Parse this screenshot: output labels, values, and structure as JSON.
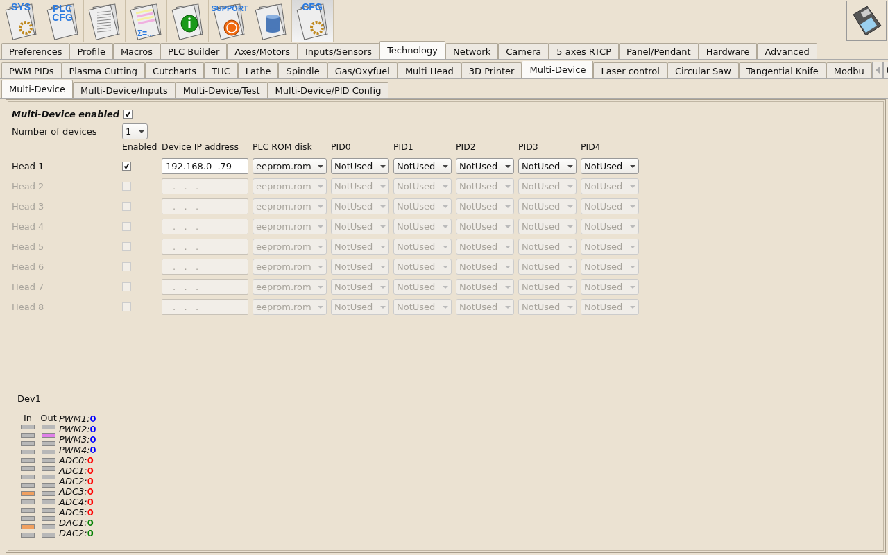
{
  "toolbar": [
    {
      "kind": "gear",
      "label": "SYS",
      "selected": false
    },
    {
      "kind": "text",
      "label": "PLC CFG",
      "selected": false
    },
    {
      "kind": "lines",
      "selected": false
    },
    {
      "kind": "sheet",
      "label": "Σ=...",
      "selected": false
    },
    {
      "kind": "info",
      "selected": false
    },
    {
      "kind": "phone",
      "label": "SUPPORT",
      "selected": false
    },
    {
      "kind": "database",
      "selected": false
    },
    {
      "kind": "gear",
      "label": "CFG",
      "selected": true
    }
  ],
  "main_tabs": [
    {
      "label": "Preferences",
      "selected": false
    },
    {
      "label": "Profile",
      "selected": false
    },
    {
      "label": "Macros",
      "selected": false
    },
    {
      "label": "PLC Builder",
      "selected": false
    },
    {
      "label": "Axes/Motors",
      "selected": false
    },
    {
      "label": "Inputs/Sensors",
      "selected": false
    },
    {
      "label": "Technology",
      "selected": true
    },
    {
      "label": "Network",
      "selected": false
    },
    {
      "label": "Camera",
      "selected": false
    },
    {
      "label": "5 axes RTCP",
      "selected": false
    },
    {
      "label": "Panel/Pendant",
      "selected": false
    },
    {
      "label": "Hardware",
      "selected": false
    },
    {
      "label": "Advanced",
      "selected": false
    }
  ],
  "tech_tabs": [
    {
      "label": "PWM PIDs",
      "selected": false
    },
    {
      "label": "Plasma Cutting",
      "selected": false
    },
    {
      "label": "Cutcharts",
      "selected": false
    },
    {
      "label": "THC",
      "selected": false
    },
    {
      "label": "Lathe",
      "selected": false
    },
    {
      "label": "Spindle",
      "selected": false
    },
    {
      "label": "Gas/Oxyfuel",
      "selected": false
    },
    {
      "label": "Multi Head",
      "selected": false
    },
    {
      "label": "3D Printer",
      "selected": false
    },
    {
      "label": "Multi-Device",
      "selected": true
    },
    {
      "label": "Laser control",
      "selected": false
    },
    {
      "label": "Circular Saw",
      "selected": false
    },
    {
      "label": "Tangential Knife",
      "selected": false
    },
    {
      "label": "Modbu",
      "selected": false
    }
  ],
  "sub_tabs": [
    {
      "label": "Multi-Device",
      "selected": true
    },
    {
      "label": "Multi-Device/Inputs",
      "selected": false
    },
    {
      "label": "Multi-Device/Test",
      "selected": false
    },
    {
      "label": "Multi-Device/PID Config",
      "selected": false
    }
  ],
  "multi_device_enabled": {
    "label": "Multi-Device enabled",
    "checked": true
  },
  "number_of_devices": {
    "label": "Number of devices",
    "value": "1"
  },
  "columns": [
    "Enabled",
    "Device IP address",
    "PLC ROM disk",
    "PID0",
    "PID1",
    "PID2",
    "PID3",
    "PID4"
  ],
  "heads": [
    {
      "name": "Head 1",
      "enabled": true,
      "ip": "192.168.0  .79",
      "rom": "eeprom.rom",
      "pids": [
        "NotUsed",
        "NotUsed",
        "NotUsed",
        "NotUsed",
        "NotUsed"
      ]
    },
    {
      "name": "Head 2",
      "enabled": false,
      "ip": ".   .   .",
      "rom": "eeprom.rom",
      "pids": [
        "NotUsed",
        "NotUsed",
        "NotUsed",
        "NotUsed",
        "NotUsed"
      ]
    },
    {
      "name": "Head 3",
      "enabled": false,
      "ip": ".   .   .",
      "rom": "eeprom.rom",
      "pids": [
        "NotUsed",
        "NotUsed",
        "NotUsed",
        "NotUsed",
        "NotUsed"
      ]
    },
    {
      "name": "Head 4",
      "enabled": false,
      "ip": ".   .   .",
      "rom": "eeprom.rom",
      "pids": [
        "NotUsed",
        "NotUsed",
        "NotUsed",
        "NotUsed",
        "NotUsed"
      ]
    },
    {
      "name": "Head 5",
      "enabled": false,
      "ip": ".   .   .",
      "rom": "eeprom.rom",
      "pids": [
        "NotUsed",
        "NotUsed",
        "NotUsed",
        "NotUsed",
        "NotUsed"
      ]
    },
    {
      "name": "Head 6",
      "enabled": false,
      "ip": ".   .   .",
      "rom": "eeprom.rom",
      "pids": [
        "NotUsed",
        "NotUsed",
        "NotUsed",
        "NotUsed",
        "NotUsed"
      ]
    },
    {
      "name": "Head 7",
      "enabled": false,
      "ip": ".   .   .",
      "rom": "eeprom.rom",
      "pids": [
        "NotUsed",
        "NotUsed",
        "NotUsed",
        "NotUsed",
        "NotUsed"
      ]
    },
    {
      "name": "Head 8",
      "enabled": false,
      "ip": ".   .   .",
      "rom": "eeprom.rom",
      "pids": [
        "NotUsed",
        "NotUsed",
        "NotUsed",
        "NotUsed",
        "NotUsed"
      ]
    }
  ],
  "device_monitor": {
    "title": "Dev1",
    "in_label": "In",
    "out_label": "Out",
    "in_leds": [
      {
        "on": false
      },
      {
        "on": false
      },
      {
        "on": false
      },
      {
        "on": false
      },
      {
        "on": false
      },
      {
        "on": false
      },
      {
        "on": false
      },
      {
        "on": false
      },
      {
        "on": true,
        "color": "#f0a060"
      },
      {
        "on": false
      },
      {
        "on": false
      },
      {
        "on": false
      },
      {
        "on": true,
        "color": "#f0a060"
      },
      {
        "on": false
      }
    ],
    "out_leds": [
      {
        "on": false
      },
      {
        "on": true,
        "color": "#e080e8"
      },
      {
        "on": false
      },
      {
        "on": false
      },
      {
        "on": false
      },
      {
        "on": false
      },
      {
        "on": false
      },
      {
        "on": false
      },
      {
        "on": false
      },
      {
        "on": false
      },
      {
        "on": false
      },
      {
        "on": false
      },
      {
        "on": false
      },
      {
        "on": false
      }
    ],
    "signals": [
      {
        "name": "PWM1:",
        "value": "0",
        "color": "#0000ff"
      },
      {
        "name": "PWM2:",
        "value": "0",
        "color": "#0000ff"
      },
      {
        "name": "PWM3:",
        "value": "0",
        "color": "#0000ff"
      },
      {
        "name": "PWM4:",
        "value": "0",
        "color": "#0000ff"
      },
      {
        "name": "ADC0:",
        "value": "0",
        "color": "#ff0000"
      },
      {
        "name": "ADC1:",
        "value": "0",
        "color": "#ff0000"
      },
      {
        "name": "ADC2:",
        "value": "0",
        "color": "#ff0000"
      },
      {
        "name": "ADC3:",
        "value": "0",
        "color": "#ff0000"
      },
      {
        "name": "ADC4:",
        "value": "0",
        "color": "#ff0000"
      },
      {
        "name": "ADC5:",
        "value": "0",
        "color": "#ff0000"
      },
      {
        "name": "DAC1:",
        "value": "0",
        "color": "#008000"
      },
      {
        "name": "DAC2:",
        "value": "0",
        "color": "#008000"
      }
    ]
  }
}
